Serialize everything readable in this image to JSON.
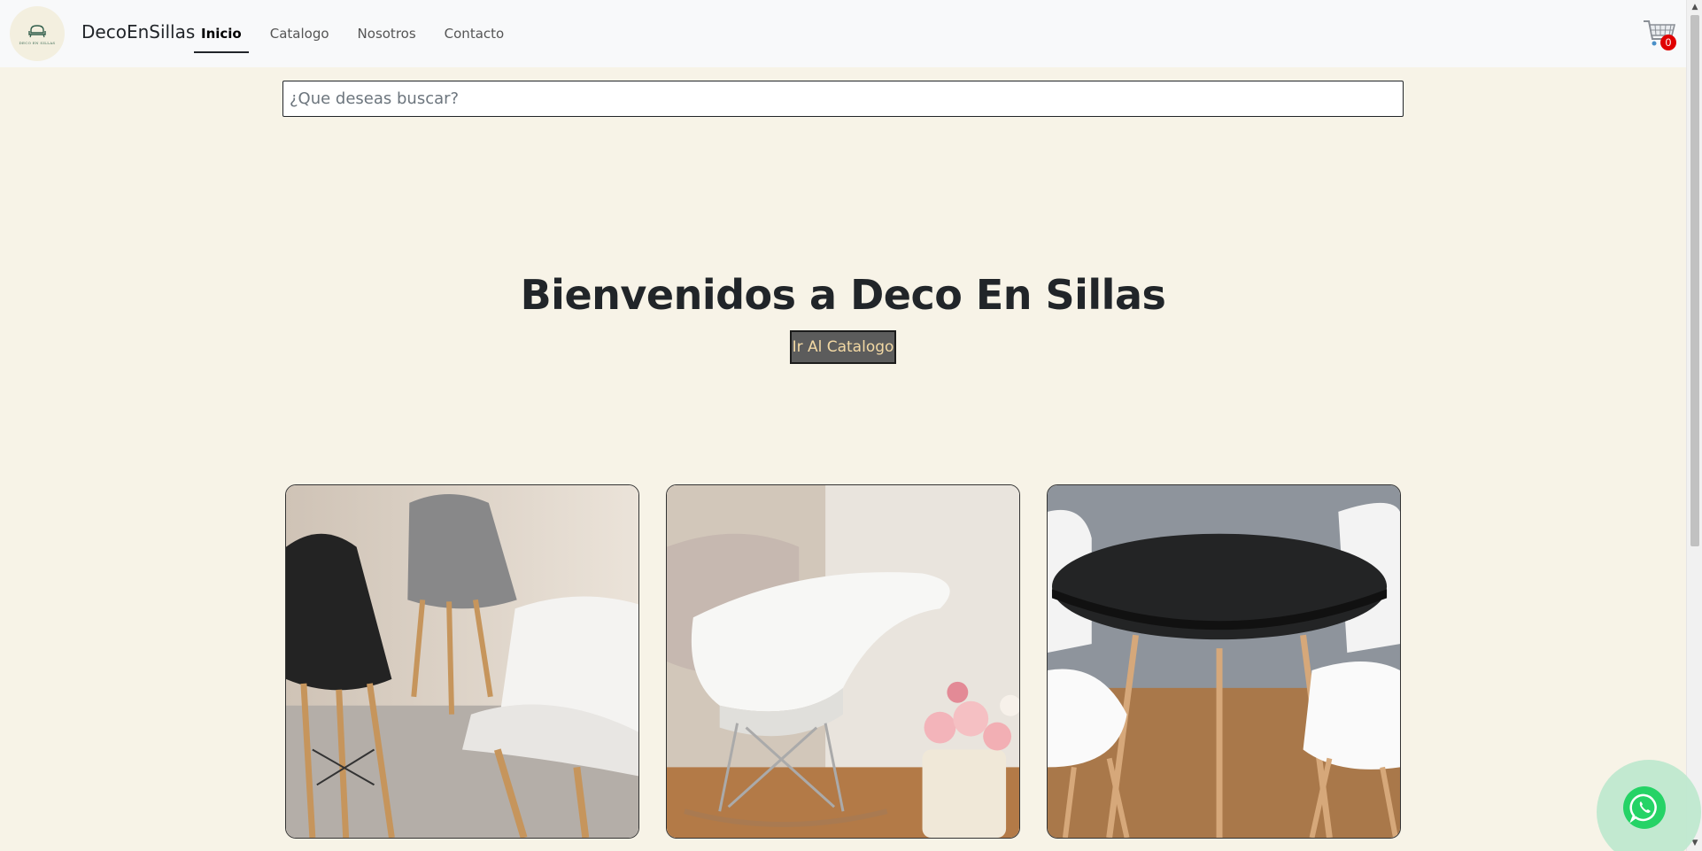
{
  "brand": {
    "logo_text": "DECO EN SILLAS",
    "name": "DecoEnSillas"
  },
  "nav": {
    "items": [
      {
        "label": "Inicio",
        "active": true
      },
      {
        "label": "Catalogo",
        "active": false
      },
      {
        "label": "Nosotros",
        "active": false
      },
      {
        "label": "Contacto",
        "active": false
      }
    ]
  },
  "cart": {
    "count": "0",
    "icon": "shopping-cart-icon"
  },
  "search": {
    "placeholder": "¿Que deseas buscar?",
    "value": ""
  },
  "hero": {
    "title": "Bienvenidos a Deco En Sillas",
    "button_label": "Ir Al Catalogo"
  },
  "products": [
    {
      "image": "tufted-chairs-black-grey-white"
    },
    {
      "image": "white-rocking-armchair-with-flowers"
    },
    {
      "image": "round-black-table-with-white-chairs"
    }
  ],
  "whatsapp": {
    "icon": "whatsapp-icon"
  },
  "colors": {
    "page_bg": "#f7f3e7",
    "navbar_bg": "#f8f9fa",
    "button_bg": "#5c5c5c",
    "button_text": "#f3d9a4",
    "badge": "#e00000",
    "whatsapp": "#25d366"
  }
}
